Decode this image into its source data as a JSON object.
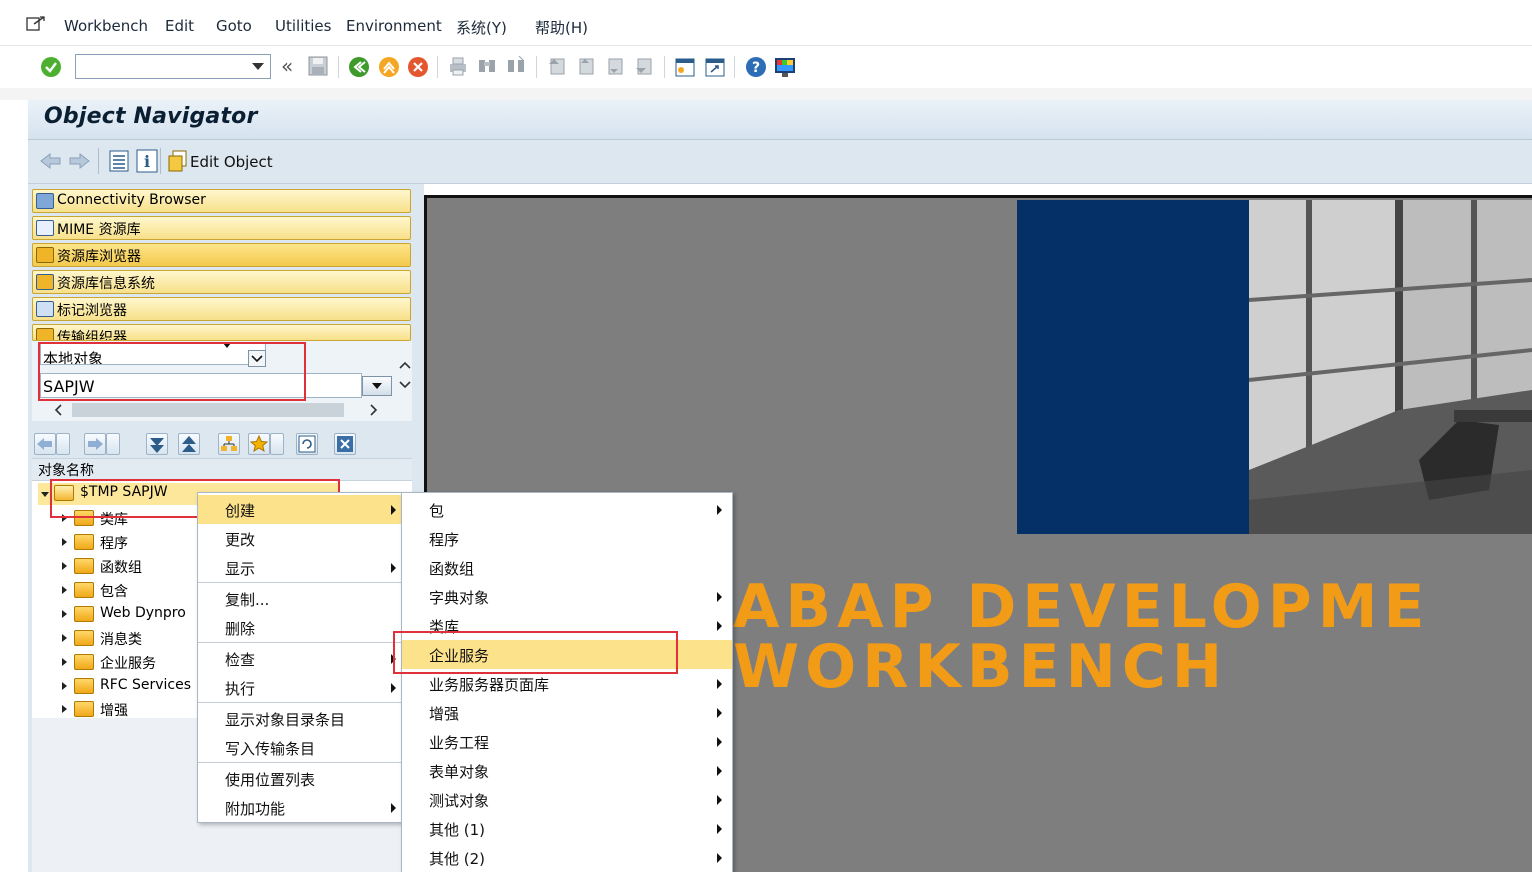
{
  "menubar": {
    "items": [
      "Workbench",
      "Edit",
      "Goto",
      "Utilities",
      "Environment",
      "系统(Y)",
      "帮助(H)"
    ]
  },
  "toolbar": {
    "command_field": "",
    "nav_back_glyph": "«"
  },
  "window": {
    "title": "Object Navigator",
    "edit_object": "Edit Object"
  },
  "nav_buttons": [
    {
      "label": "Connectivity Browser",
      "icon": "connectivity-icon"
    },
    {
      "label": "MIME 资源库",
      "icon": "mime-icon"
    },
    {
      "label": "资源库浏览器",
      "icon": "repository-browser-icon"
    },
    {
      "label": "资源库信息系统",
      "icon": "repository-info-icon"
    },
    {
      "label": "标记浏览器",
      "icon": "tag-browser-icon"
    },
    {
      "label": "传输组织器",
      "icon": "transport-organizer-icon"
    }
  ],
  "selection": {
    "object_type": "本地对象",
    "object_name": "SAPJW"
  },
  "tree": {
    "header": "对象名称",
    "root": "$TMP SAPJW",
    "children": [
      "类库",
      "程序",
      "函数组",
      "包含",
      "Web Dynpro",
      "消息类",
      "企业服务",
      "RFC Services",
      "增强"
    ]
  },
  "context_menu": {
    "items": [
      {
        "label": "创建",
        "submenu": true,
        "highlighted": true
      },
      {
        "label": "更改",
        "submenu": false
      },
      {
        "label": "显示",
        "submenu": true
      },
      {
        "label": "复制...",
        "submenu": false
      },
      {
        "label": "删除",
        "submenu": false
      },
      {
        "label": "检查",
        "submenu": true
      },
      {
        "label": "执行",
        "submenu": true
      },
      {
        "label": "显示对象目录条目",
        "submenu": false
      },
      {
        "label": "写入传输条目",
        "submenu": false
      },
      {
        "label": "使用位置列表",
        "submenu": false
      },
      {
        "label": "附加功能",
        "submenu": true
      }
    ]
  },
  "create_submenu": {
    "items": [
      {
        "label": "包",
        "submenu": true
      },
      {
        "label": "程序",
        "submenu": false
      },
      {
        "label": "函数组",
        "submenu": false
      },
      {
        "label": "字典对象",
        "submenu": true
      },
      {
        "label": "类库",
        "submenu": true
      },
      {
        "label": "企业服务",
        "submenu": false,
        "highlighted": true
      },
      {
        "label": "业务服务器页面库",
        "submenu": true
      },
      {
        "label": "增强",
        "submenu": true
      },
      {
        "label": "业务工程",
        "submenu": true
      },
      {
        "label": "表单对象",
        "submenu": true
      },
      {
        "label": "测试对象",
        "submenu": true
      },
      {
        "label": "其他 (1)",
        "submenu": true
      },
      {
        "label": "其他 (2)",
        "submenu": true
      }
    ]
  },
  "banner": {
    "line1": "ABAP DEVELOPME",
    "line2": "WORKBENCH"
  },
  "colors": {
    "banner": "#f29b17",
    "highlight": "#fde28c",
    "annotation_box": "#e0303a",
    "picture_bg": "#7e7e7e",
    "blue_block": "#053067"
  }
}
